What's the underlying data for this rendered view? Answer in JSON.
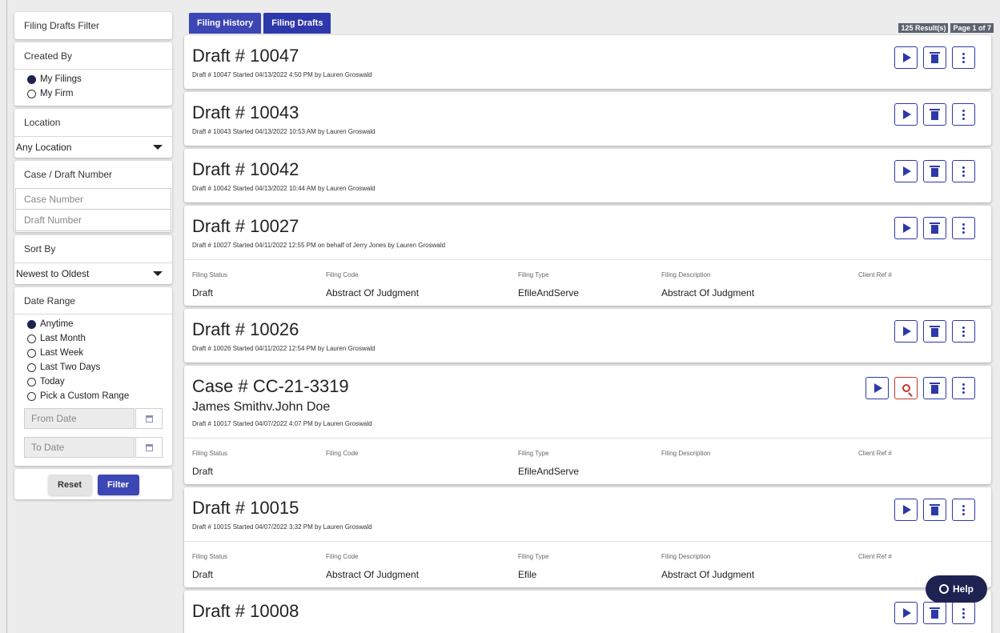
{
  "sidebar": {
    "filter_title": "Filing Drafts Filter",
    "created_by": {
      "title": "Created By",
      "options": [
        "My Filings",
        "My Firm"
      ],
      "selected": "My Filings"
    },
    "location": {
      "title": "Location",
      "value": "Any Location"
    },
    "case_draft": {
      "title": "Case / Draft Number",
      "case_placeholder": "Case Number",
      "draft_placeholder": "Draft Number"
    },
    "sort": {
      "title": "Sort By",
      "value": "Newest to Oldest"
    },
    "date_range": {
      "title": "Date Range",
      "options": [
        "Anytime",
        "Last Month",
        "Last Week",
        "Last Two Days",
        "Today",
        "Pick a Custom Range"
      ],
      "selected": "Anytime",
      "from_placeholder": "From Date",
      "to_placeholder": "To Date"
    },
    "reset_label": "Reset",
    "filter_label": "Filter"
  },
  "tabs": [
    {
      "label": "Filing History"
    },
    {
      "label": "Filing Drafts"
    }
  ],
  "results": {
    "count": "125 Result(s)",
    "page": "Page 1 of 7"
  },
  "detail_headers": {
    "status": "Filing Status",
    "code": "Filing Code",
    "type": "Filing Type",
    "description": "Filing Description",
    "client_ref": "Client Ref #"
  },
  "cards": [
    {
      "title": "Draft # 10047",
      "meta": "Draft # 10047 Started 04/13/2022 4:50 PM by Lauren Groswald"
    },
    {
      "title": "Draft # 10043",
      "meta": "Draft # 10043 Started 04/13/2022 10:53 AM by Lauren Groswald"
    },
    {
      "title": "Draft # 10042",
      "meta": "Draft # 10042 Started 04/13/2022 10:44 AM by Lauren Groswald"
    },
    {
      "title": "Draft # 10027",
      "meta": "Draft # 10027 Started 04/11/2022 12:55 PM on behalf of Jerry Jones by Lauren Groswald",
      "details": {
        "status": "Draft",
        "code": "Abstract Of Judgment",
        "type": "EfileAndServe",
        "description": "Abstract Of Judgment",
        "client_ref": ""
      }
    },
    {
      "title": "Draft # 10026",
      "meta": "Draft # 10026 Started 04/11/2022 12:54 PM by Lauren Groswald"
    },
    {
      "title": "Case # CC-21-3319",
      "subtitle": "James Smithv.John Doe",
      "meta": "Draft # 10017 Started 04/07/2022 4:07 PM by Lauren Groswald",
      "details": {
        "status": "Draft",
        "code": "",
        "type": "EfileAndServe",
        "description": "",
        "client_ref": ""
      }
    },
    {
      "title": "Draft # 10015",
      "meta": "Draft # 10015 Started 04/07/2022 3:32 PM by Lauren Groswald",
      "details": {
        "status": "Draft",
        "code": "Abstract Of Judgment",
        "type": "Efile",
        "description": "Abstract Of Judgment",
        "client_ref": ""
      }
    },
    {
      "title": "Draft # 10008"
    }
  ],
  "help_label": "Help",
  "colors": {
    "primary": "#3c46b4",
    "dark_navy": "#1e2251",
    "danger": "#c0392b"
  }
}
